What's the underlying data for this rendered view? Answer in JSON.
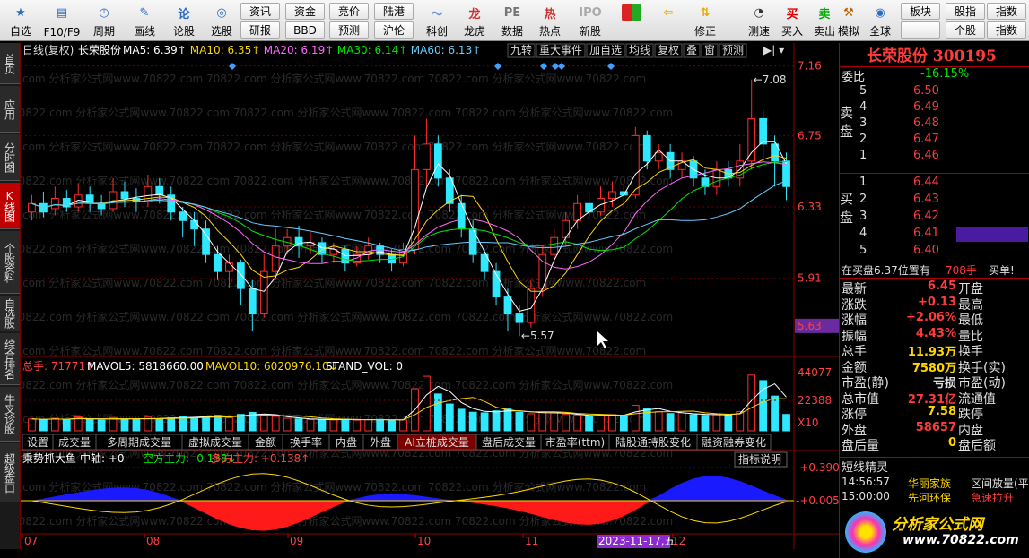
{
  "toolbar": {
    "items": [
      {
        "label": "自选",
        "icon": "star-icon"
      },
      {
        "label": "F10/F9",
        "icon": "f10-icon"
      },
      {
        "label": "周期",
        "icon": "clock-icon"
      },
      {
        "label": "画线",
        "icon": "pen-icon"
      },
      {
        "label": "论股",
        "icon": "forum-icon"
      },
      {
        "label": "选股",
        "icon": "select-stock-icon"
      },
      {
        "label": "科创",
        "icon": "kechuang-icon"
      },
      {
        "label": "龙虎",
        "icon": "dragon-tiger-icon"
      },
      {
        "label": "数据",
        "icon": "pe-data-icon"
      },
      {
        "label": "热点",
        "icon": "hot-icon"
      },
      {
        "label": "新股",
        "icon": "ipo-icon"
      },
      {
        "label": "",
        "icon": "color-grid-icon"
      },
      {
        "label": "",
        "icon": "back-arrow-icon"
      },
      {
        "label": "修正",
        "icon": "correct-icon"
      },
      {
        "label": "测速",
        "icon": "speedtest-icon"
      },
      {
        "label": "买入",
        "icon": "buy-icon"
      },
      {
        "label": "卖出",
        "icon": "sell-icon"
      },
      {
        "label": "模拟",
        "icon": "simulate-icon"
      },
      {
        "label": "全球",
        "icon": "globe-icon"
      }
    ],
    "small_buttons": [
      "资讯",
      "资金",
      "竞价",
      "陆港",
      "研报",
      "BBD",
      "预测",
      "沪伦",
      "板块",
      "股指",
      "指数",
      "个股",
      "指数"
    ]
  },
  "sidebar": [
    "首页",
    "应用",
    "分时图",
    "K线图",
    "个股资料",
    "自选股",
    "综合排名",
    "牛叉诊股",
    "超级盘口"
  ],
  "chart": {
    "header": "日线(复权)",
    "stock": "长荣股份",
    "ma": [
      {
        "label": "MA5: 6.39",
        "color": "#ffffff"
      },
      {
        "label": "MA10: 6.35",
        "color": "#ffd700"
      },
      {
        "label": "MA20: 6.19",
        "color": "#ff66ff"
      },
      {
        "label": "MA30: 6.14",
        "color": "#00e600"
      },
      {
        "label": "MA60: 6.13",
        "color": "#66ccff"
      }
    ],
    "tools": [
      "九转",
      "重大事件",
      "加自选",
      "均线",
      "复权",
      "叠",
      "窗",
      "预测"
    ],
    "price_ticks": [
      "7.16",
      "6.75",
      "6.33",
      "5.91",
      "5.63"
    ],
    "high_label": "7.08",
    "low_label": "5.57",
    "vol_header": {
      "total": "总手: 71771",
      "mavol5": "MAVOL5: 5818660.00",
      "mavol10": "MAVOL10: 6020976.10",
      "std": "STAND_VOL: 0"
    },
    "vol_ticks": [
      "44077",
      "22388",
      "X10"
    ],
    "ind_tabs": [
      "设置",
      "成交量",
      "多周期成交量",
      "虚拟成交量",
      "金额",
      "换手率",
      "内盘",
      "外盘",
      "AI立桩成交量",
      "盘后成交量",
      "市盈率(ttm)",
      "陆股通持股变化",
      "融资融券变化"
    ],
    "ind_header": {
      "name": "乘势抓大鱼",
      "mid": "中轴: +0",
      "bull": "空方主力: -0.138",
      "bear": "多方主力: +0.138"
    },
    "ind_button": "指标说明",
    "ind_ticks": [
      "+0.390",
      "+0.005"
    ],
    "months": [
      "07",
      "08",
      "09",
      "10",
      "11",
      "12"
    ],
    "date_cursor": "2023-11-17,五",
    "watermark": "70822.com 分析家公式网www.70822.com"
  },
  "chart_data": {
    "type": "candlestick",
    "title": "长荣股份 日线(复权)",
    "ylim": [
      5.5,
      7.2
    ],
    "candles": [
      [
        6.3,
        6.35,
        6.4,
        6.25
      ],
      [
        6.35,
        6.3,
        6.42,
        6.27
      ],
      [
        6.32,
        6.38,
        6.45,
        6.28
      ],
      [
        6.38,
        6.33,
        6.43,
        6.3
      ],
      [
        6.33,
        6.4,
        6.47,
        6.3
      ],
      [
        6.4,
        6.35,
        6.45,
        6.3
      ],
      [
        6.35,
        6.32,
        6.4,
        6.28
      ],
      [
        6.32,
        6.42,
        6.5,
        6.3
      ],
      [
        6.42,
        6.38,
        6.48,
        6.33
      ],
      [
        6.38,
        6.36,
        6.44,
        6.3
      ],
      [
        6.36,
        6.45,
        6.52,
        6.33
      ],
      [
        6.45,
        6.4,
        6.5,
        6.35
      ],
      [
        6.4,
        6.3,
        6.45,
        6.25
      ],
      [
        6.3,
        6.25,
        6.33,
        6.15
      ],
      [
        6.25,
        6.2,
        6.3,
        6.1
      ],
      [
        6.2,
        6.05,
        6.25,
        6.0
      ],
      [
        6.05,
        5.95,
        6.1,
        5.9
      ],
      [
        5.95,
        6.0,
        6.05,
        5.85
      ],
      [
        6.0,
        5.85,
        6.02,
        5.75
      ],
      [
        5.85,
        5.7,
        5.9,
        5.6
      ],
      [
        5.7,
        5.95,
        6.05,
        5.68
      ],
      [
        5.95,
        6.1,
        6.2,
        5.9
      ],
      [
        6.1,
        6.15,
        6.2,
        6.05
      ],
      [
        6.15,
        6.1,
        6.22,
        6.03
      ],
      [
        6.1,
        6.12,
        6.18,
        6.05
      ],
      [
        6.12,
        6.05,
        6.15,
        6.0
      ],
      [
        6.05,
        6.08,
        6.12,
        6.0
      ],
      [
        6.08,
        6.0,
        6.1,
        5.95
      ],
      [
        6.0,
        6.05,
        6.1,
        5.98
      ],
      [
        6.05,
        6.1,
        6.15,
        6.02
      ],
      [
        6.1,
        6.05,
        6.12,
        6.0
      ],
      [
        6.05,
        6.0,
        6.08,
        5.95
      ],
      [
        6.0,
        6.08,
        6.12,
        5.98
      ],
      [
        6.08,
        6.55,
        6.75,
        6.05
      ],
      [
        6.55,
        6.7,
        6.85,
        6.45
      ],
      [
        6.7,
        6.5,
        6.75,
        6.45
      ],
      [
        6.5,
        6.35,
        6.55,
        6.3
      ],
      [
        6.35,
        6.2,
        6.4,
        6.15
      ],
      [
        6.2,
        6.05,
        6.25,
        6.0
      ],
      [
        6.05,
        5.95,
        6.08,
        5.9
      ],
      [
        5.95,
        5.8,
        6.0,
        5.75
      ],
      [
        5.8,
        5.7,
        5.85,
        5.6
      ],
      [
        5.7,
        5.65,
        5.75,
        5.57
      ],
      [
        5.65,
        5.85,
        5.9,
        5.62
      ],
      [
        5.85,
        6.05,
        6.1,
        5.8
      ],
      [
        6.05,
        6.15,
        6.2,
        6.0
      ],
      [
        6.15,
        6.25,
        6.3,
        6.1
      ],
      [
        6.25,
        6.35,
        6.4,
        6.2
      ],
      [
        6.35,
        6.3,
        6.42,
        6.25
      ],
      [
        6.3,
        6.38,
        6.45,
        6.28
      ],
      [
        6.38,
        6.42,
        6.48,
        6.33
      ],
      [
        6.42,
        6.4,
        6.46,
        6.35
      ],
      [
        6.4,
        6.75,
        6.8,
        6.38
      ],
      [
        6.75,
        6.6,
        6.78,
        6.55
      ],
      [
        6.6,
        6.65,
        6.7,
        6.55
      ],
      [
        6.65,
        6.55,
        6.7,
        6.5
      ],
      [
        6.55,
        6.6,
        6.65,
        6.5
      ],
      [
        6.6,
        6.5,
        6.63,
        6.45
      ],
      [
        6.5,
        6.45,
        6.55,
        6.4
      ],
      [
        6.45,
        6.55,
        6.6,
        6.4
      ],
      [
        6.55,
        6.5,
        6.6,
        6.45
      ],
      [
        6.5,
        6.6,
        6.7,
        6.45
      ],
      [
        6.6,
        6.85,
        7.08,
        6.55
      ],
      [
        6.85,
        6.7,
        6.9,
        6.6
      ],
      [
        6.7,
        6.6,
        6.75,
        6.45
      ],
      [
        6.6,
        6.45,
        6.65,
        6.37
      ]
    ],
    "volume": [
      5.2,
      4.8,
      5.5,
      4.9,
      6.1,
      5.0,
      4.7,
      5.8,
      5.1,
      4.9,
      6.0,
      5.3,
      5.6,
      6.2,
      5.9,
      6.5,
      6.8,
      5.7,
      7.2,
      8.1,
      6.9,
      6.3,
      5.5,
      5.2,
      4.9,
      5.0,
      4.8,
      5.1,
      4.7,
      4.9,
      5.0,
      4.6,
      4.8,
      18.5,
      24.0,
      16.2,
      11.8,
      9.5,
      8.2,
      7.9,
      8.8,
      9.6,
      8.1,
      7.5,
      8.3,
      7.9,
      7.2,
      6.8,
      6.5,
      6.9,
      7.1,
      6.6,
      11.2,
      9.8,
      8.4,
      7.6,
      7.9,
      7.1,
      6.8,
      7.4,
      7.0,
      8.5,
      24.5,
      22.1,
      15.3,
      7.2
    ],
    "volume_ticks": [
      44077,
      22388
    ],
    "indicator_lines": [
      0.39,
      0.005
    ]
  },
  "quote": {
    "title": "长荣股份 300195",
    "weibi_label": "委比",
    "weibi": "-16.15%",
    "sell_label": "卖盘",
    "buy_label": "买盘",
    "sell": [
      {
        "n": "5",
        "p": "6.50"
      },
      {
        "n": "4",
        "p": "6.49"
      },
      {
        "n": "3",
        "p": "6.48"
      },
      {
        "n": "2",
        "p": "6.47"
      },
      {
        "n": "1",
        "p": "6.46"
      }
    ],
    "buy": [
      {
        "n": "1",
        "p": "6.44"
      },
      {
        "n": "2",
        "p": "6.43"
      },
      {
        "n": "3",
        "p": "6.42"
      },
      {
        "n": "4",
        "p": "6.41"
      },
      {
        "n": "5",
        "p": "6.40"
      }
    ],
    "pending": {
      "text": "在买盘6.37位置有",
      "qty": "708手",
      "act": "买单!"
    },
    "stats": [
      [
        "最新",
        "6.45",
        "开盘",
        ""
      ],
      [
        "涨跌",
        "+0.13",
        "最高",
        ""
      ],
      [
        "涨幅",
        "+2.06%",
        "最低",
        ""
      ],
      [
        "振幅",
        "4.43%",
        "量比",
        ""
      ],
      [
        "总手",
        "11.93万",
        "换手",
        ""
      ],
      [
        "金额",
        "7580万",
        "换手(实)",
        ""
      ],
      [
        "市盈(静)",
        "亏损",
        "市盈(动)",
        ""
      ],
      [
        "总市值",
        "27.31亿",
        "流通值",
        ""
      ],
      [
        "涨停",
        "7.58",
        "跌停",
        ""
      ],
      [
        "外盘",
        "58657",
        "内盘",
        ""
      ],
      [
        "盘后量",
        "0",
        "盘后额",
        ""
      ]
    ],
    "sprite_title": "短线精灵",
    "sprite": [
      {
        "t": "14:56:57",
        "s": "华丽家族",
        "e": "区间放量(平)"
      },
      {
        "t": "15:00:00",
        "s": "先河环保",
        "e": "急速拉升"
      }
    ],
    "logo": "分析家公式网",
    "logo_url": "www.70822.com"
  }
}
